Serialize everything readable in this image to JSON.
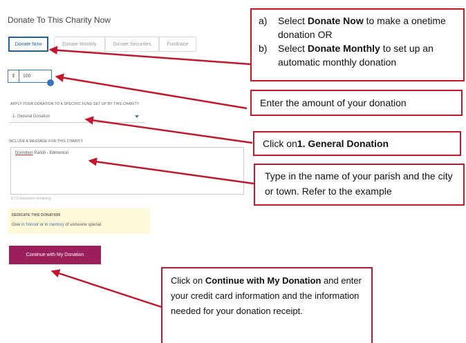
{
  "form": {
    "title": "Donate To This Charity Now",
    "tabs": [
      {
        "label": "Donate Now"
      },
      {
        "label": "Donate Monthly"
      },
      {
        "label": "Donate Securities"
      },
      {
        "label": "Fundraise"
      }
    ],
    "amount": {
      "currency": "$",
      "value": "100"
    },
    "fund_label": "APPLY YOUR DONATION TO A SPECIFIC FUND SET UP BY THIS CHARITY",
    "fund_selected": "1- General Donation",
    "message_label": "INCLUDE A MESSAGE FOR THIS CHARITY",
    "message_word1": "Dormition",
    "message_rest": " Parish - Edmonton",
    "chars_remaining": "1173 characters remaining",
    "dedicate_heading": "DEDICATE THIS DONATION",
    "dedicate_give": "Give ",
    "dedicate_honour": "in honour",
    "dedicate_or": " or ",
    "dedicate_memory": "in memory",
    "dedicate_tail": " of someone special",
    "continue_label": "Continue with My Donation"
  },
  "callouts": {
    "c1_a_num": "a)",
    "c1_a_pre": "Select ",
    "c1_a_bold": "Donate Now",
    "c1_a_post": " to make a onetime donation OR",
    "c1_b_num": "b)",
    "c1_b_pre": "Select ",
    "c1_b_bold": "Donate Monthly",
    "c1_b_post": " to set up an automatic monthly donation",
    "c2": "Enter the amount of your donation",
    "c3_pre": "Click on ",
    "c3_bold": "1. General Donation",
    "c4": "Type in the name of your parish and the city or town.  Refer to the example",
    "c5_pre": "Click on ",
    "c5_bold": "Continue with My Donation",
    "c5_post": " and enter your credit card information and the information needed for your donation receipt."
  },
  "colors": {
    "accent_blue": "#1f5fa3",
    "cta": "#9a1f5a",
    "callout_border": "#c3162c",
    "dedicate_bg": "#fdf9d8"
  }
}
